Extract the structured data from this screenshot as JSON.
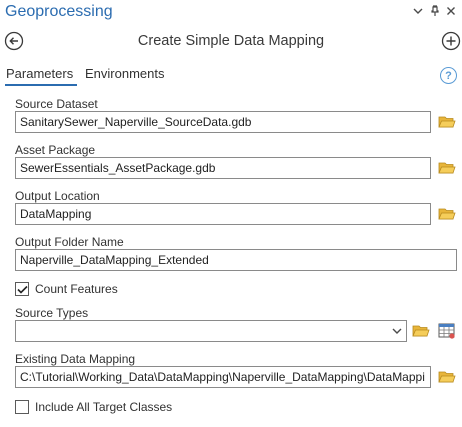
{
  "header": {
    "title": "Geoprocessing",
    "menu_icon": "chevron-down-icon",
    "pin_icon": "pin-icon",
    "close_icon": "close-icon"
  },
  "tool": {
    "title": "Create Simple Data Mapping",
    "back_icon": "back-arrow-icon",
    "add_icon": "plus-icon"
  },
  "tabs": [
    {
      "label": "Parameters",
      "active": true
    },
    {
      "label": "Environments",
      "active": false
    }
  ],
  "help_label": "?",
  "params": {
    "source_dataset": {
      "label": "Source Dataset",
      "value": "SanitarySewer_Naperville_SourceData.gdb"
    },
    "asset_package": {
      "label": "Asset Package",
      "value": "SewerEssentials_AssetPackage.gdb"
    },
    "output_location": {
      "label": "Output Location",
      "value": "DataMapping"
    },
    "output_folder_name": {
      "label": "Output Folder Name",
      "value": "Naperville_DataMapping_Extended"
    },
    "count_features": {
      "label": "Count Features",
      "checked": true
    },
    "source_types": {
      "label": "Source Types",
      "value": ""
    },
    "existing_data_mapping": {
      "label": "Existing Data Mapping",
      "value": "C:\\Tutorial\\Working_Data\\DataMapping\\Naperville_DataMapping\\DataMappi"
    },
    "include_all_target_classes": {
      "label": "Include All Target Classes",
      "checked": false
    }
  },
  "colors": {
    "accent": "#2b6cb0",
    "folder": "#e8b53a",
    "help": "#5a9bd5"
  }
}
